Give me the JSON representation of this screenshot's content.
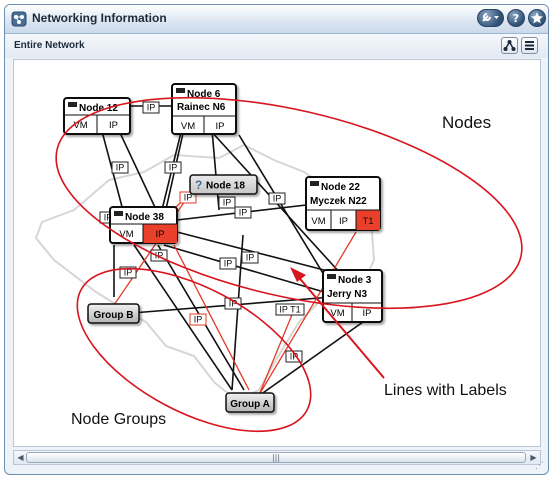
{
  "window": {
    "title": "Networking Information",
    "subtitle": "Entire Network",
    "colors": {
      "titlebar_bg": "#d9e4f0",
      "button_blue": "#35577f",
      "alert_red": "#e8412c",
      "annotation_red": "#d8141e"
    },
    "buttons": {
      "tools_icon": "wrench-icon",
      "help_label": "?",
      "help_icon": "help-icon",
      "star_icon": "star-icon",
      "tree_icon": "tree-layout-icon",
      "list_icon": "list-icon"
    },
    "scrollbar": {
      "left_arrow": "◀",
      "right_arrow": "▶",
      "grip": "|||",
      "resize_grip": "⋰"
    }
  },
  "network": {
    "nodes": [
      {
        "id": "n12",
        "line1": "Node 12",
        "line2": "",
        "cells": [
          "VM",
          "IP"
        ],
        "alerts": []
      },
      {
        "id": "n6",
        "line1": "Node 6",
        "line2": "Rainec N6",
        "cells": [
          "VM",
          "IP"
        ],
        "alerts": []
      },
      {
        "id": "n18",
        "line1": "Node 18",
        "line2": "",
        "cells": [],
        "alerts": [],
        "state": "unknown"
      },
      {
        "id": "n22",
        "line1": "Node 22",
        "line2": "Myczek N22",
        "cells": [
          "VM",
          "IP",
          "T1"
        ],
        "alerts": [
          2
        ]
      },
      {
        "id": "n38",
        "line1": "Node 38",
        "line2": "",
        "cells": [
          "VM",
          "IP"
        ],
        "alerts": [
          1
        ]
      },
      {
        "id": "n3",
        "line1": "Node 3",
        "line2": "Jerry N3",
        "cells": [
          "VM",
          "IP"
        ],
        "alerts": []
      }
    ],
    "groups": [
      {
        "id": "gb",
        "label": "Group B"
      },
      {
        "id": "ga",
        "label": "Group A"
      }
    ],
    "link_labels": {
      "ip": "IP",
      "t1": "T1",
      "ip_t1": "IP T1"
    }
  },
  "annotations": {
    "nodes": "Nodes",
    "lines": "Lines with Labels",
    "groups": "Node Groups"
  }
}
